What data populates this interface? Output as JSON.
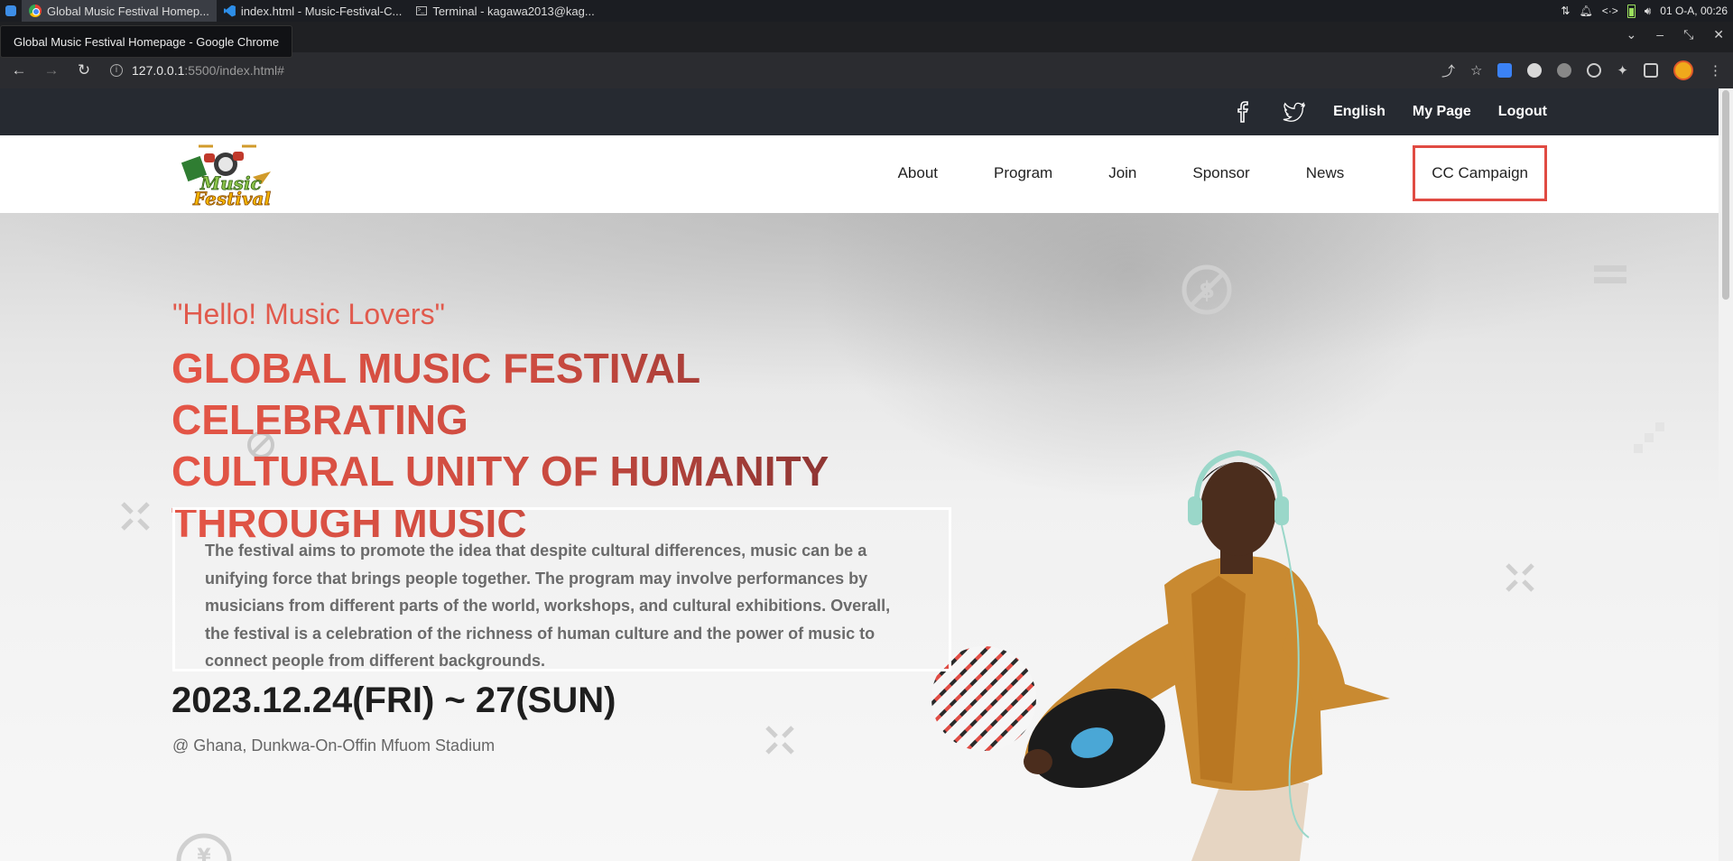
{
  "os": {
    "tasks": [
      {
        "label": "Global Music Festival Homep...",
        "icon": "chrome-icon",
        "active": true
      },
      {
        "label": "index.html - Music-Festival-C...",
        "icon": "vscode-icon",
        "active": false
      },
      {
        "label": "Terminal - kagawa2013@kag...",
        "icon": "terminal-icon",
        "active": false
      }
    ],
    "clock": "01 O-A, 00:26"
  },
  "browser": {
    "tooltip": "Global Music Festival Homepage - Google Chrome",
    "url_host": "127.0.0.1",
    "url_path": ":5500/index.html#"
  },
  "utility": {
    "links": [
      "English",
      "My Page",
      "Logout"
    ]
  },
  "nav": {
    "logo_text": "Music Festival",
    "items": [
      "About",
      "Program",
      "Join",
      "Sponsor",
      "News"
    ],
    "highlighted": "CC Campaign"
  },
  "hero": {
    "greeting": "\"Hello! Music Lovers\"",
    "headline_lines": [
      "GLOBAL MUSIC FESTIVAL CELEBRATING",
      "CULTURAL UNITY OF HUMANITY",
      "THROUGH MUSIC"
    ],
    "description": "The festival aims to promote the idea that despite cultural differences, music can be a unifying force that brings people together. The program may involve performances by musicians from different parts of the world, workshops, and cultural exhibitions. Overall, the festival is a celebration of the richness of human culture and the power of music to connect people from different backgrounds.",
    "date": "2023.12.24(FRI) ~ 27(SUN)",
    "venue": "@ Ghana, Dunkwa-On-Offin Mfuom Stadium"
  },
  "colors": {
    "accent": "#e04b43",
    "headline_start": "#e45546",
    "headline_end": "#6d2a2c",
    "utility_bar": "#262a31"
  }
}
